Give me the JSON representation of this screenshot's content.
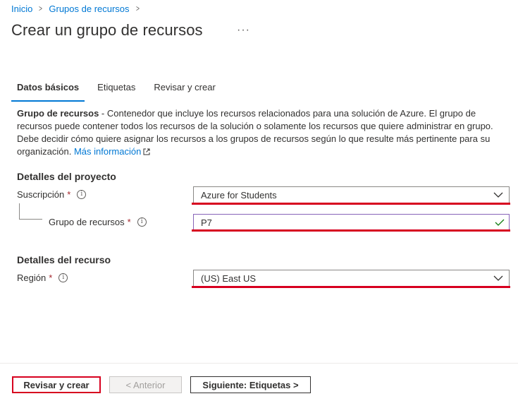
{
  "breadcrumb": {
    "home": "Inicio",
    "parent": "Grupos de recursos",
    "sep": ">"
  },
  "page": {
    "title": "Crear un grupo de recursos",
    "more": "···"
  },
  "tabs": [
    {
      "label": "Datos básicos",
      "active": true
    },
    {
      "label": "Etiquetas",
      "active": false
    },
    {
      "label": "Revisar y crear",
      "active": false
    }
  ],
  "description": {
    "term": "Grupo de recursos",
    "text": " - Contenedor que incluye los recursos relacionados para una solución de Azure. El grupo de recursos puede contener todos los recursos de la solución o solamente los recursos que quiere administrar en grupo. Debe decidir cómo quiere asignar los recursos a los grupos de recursos según lo que resulte más pertinente para su organización. ",
    "link": "Más información"
  },
  "project": {
    "heading": "Detalles del proyecto",
    "subscription_label": "Suscripción",
    "subscription_value": "Azure for Students",
    "rg_label": "Grupo de recursos",
    "rg_value": "P7"
  },
  "resource": {
    "heading": "Detalles del recurso",
    "region_label": "Región",
    "region_value": "(US) East US"
  },
  "required_mark": "*",
  "info_glyph": "i",
  "footer": {
    "review_create": "Revisar y crear",
    "previous": "< Anterior",
    "next": "Siguiente: Etiquetas >"
  },
  "colors": {
    "accent": "#0078d4",
    "highlight": "#d7001f",
    "valid": "#107c10",
    "required": "#a4262c"
  }
}
